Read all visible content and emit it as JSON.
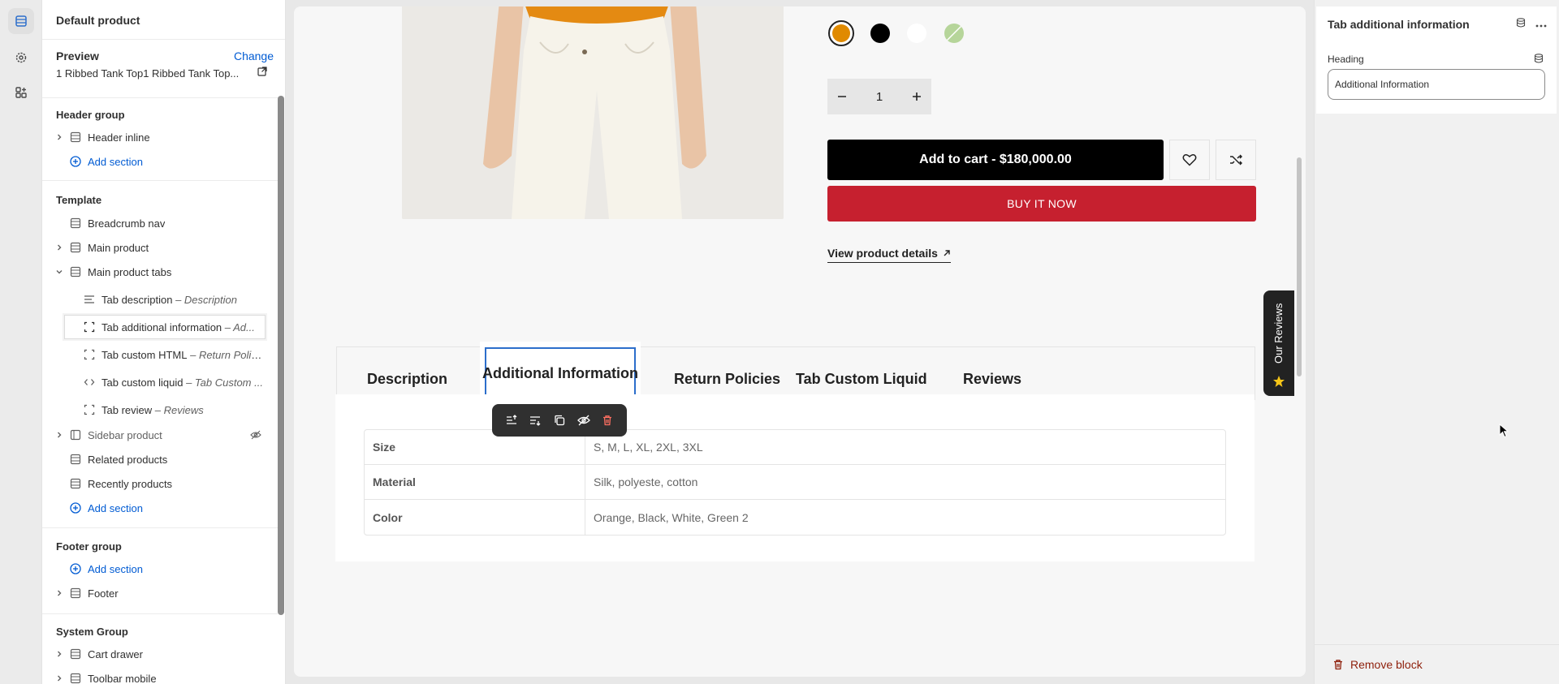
{
  "rail": {
    "items": [
      "sections-icon",
      "settings-icon",
      "apps-icon"
    ]
  },
  "sidebar": {
    "title": "Default product",
    "preview": {
      "label": "Preview",
      "change": "Change",
      "value": "1 Ribbed Tank Top1 Ribbed Tank Top..."
    },
    "header_group": {
      "title": "Header group",
      "items": [
        {
          "label": "Header inline",
          "icon": "section-icon"
        }
      ],
      "add_section": "Add section"
    },
    "template": {
      "title": "Template",
      "items": [
        {
          "label": "Breadcrumb nav",
          "icon": "section-icon"
        },
        {
          "label": "Main product",
          "icon": "section-icon"
        },
        {
          "label": "Main product tabs",
          "icon": "section-icon"
        }
      ],
      "blocks": [
        {
          "label": "Tab description",
          "sub": " – Description",
          "icon": "text-icon"
        },
        {
          "label": "Tab additional information",
          "sub": " – Ad...",
          "icon": "block-icon",
          "selected": true
        },
        {
          "label": "Tab custom HTML",
          "sub": " – Return Polic...",
          "icon": "block-icon"
        },
        {
          "label": "Tab custom liquid",
          "sub": " – Tab Custom ...",
          "icon": "code-icon"
        },
        {
          "label": "Tab review",
          "sub": " – Reviews",
          "icon": "block-icon"
        }
      ],
      "items_after": [
        {
          "label": "Sidebar product",
          "icon": "sidebar-icon",
          "hidden": true
        },
        {
          "label": "Related products",
          "icon": "section-icon"
        },
        {
          "label": "Recently products",
          "icon": "section-icon"
        }
      ],
      "add_section": "Add section"
    },
    "footer_group": {
      "title": "Footer group",
      "add_section": "Add section",
      "items": [
        {
          "label": "Footer",
          "icon": "section-icon"
        }
      ]
    },
    "system_group": {
      "title": "System Group",
      "items": [
        {
          "label": "Cart drawer",
          "icon": "section-icon"
        },
        {
          "label": "Toolbar mobile",
          "icon": "section-icon"
        }
      ]
    }
  },
  "product": {
    "swatches": [
      "#e08a00",
      "#000000",
      "#ffffff",
      "#b6d59a"
    ],
    "quantity": "1",
    "add_to_cart": "Add to cart - $180,000.00",
    "buy_now": "BUY IT NOW",
    "view_details": "View product details",
    "accent_red": "#c6202f"
  },
  "tabs": {
    "items": [
      "Description",
      "Additional Information",
      "Return Policies",
      "Tab Custom Liquid",
      "Reviews"
    ],
    "active": "Additional Information",
    "table": [
      {
        "key": "Size",
        "value": "S, M, L, XL, 2XL, 3XL"
      },
      {
        "key": "Material",
        "value": "Silk, polyeste, cotton"
      },
      {
        "key": "Color",
        "value": "Orange, Black, White, Green 2"
      }
    ]
  },
  "reviews_widget": {
    "label": "Our Reviews"
  },
  "settings": {
    "title": "Tab additional information",
    "heading_label": "Heading",
    "heading_value": "Additional Information",
    "remove_block": "Remove block"
  }
}
